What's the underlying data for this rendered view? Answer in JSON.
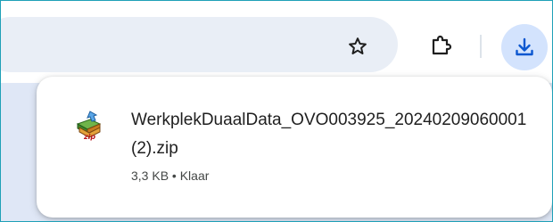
{
  "toolbar": {
    "bookmark_icon": "star-outline-icon",
    "extensions_icon": "puzzle-piece-icon",
    "downloads_icon": "download-arrow-icon",
    "accent_color": "#0b57d0"
  },
  "download_bubble": {
    "file_icon": "zip-archive-icon",
    "file_name": "WerkplekDuaalData_OVO003925_20240209060001 (2).zip",
    "status": "3,3  KB • Klaar"
  }
}
